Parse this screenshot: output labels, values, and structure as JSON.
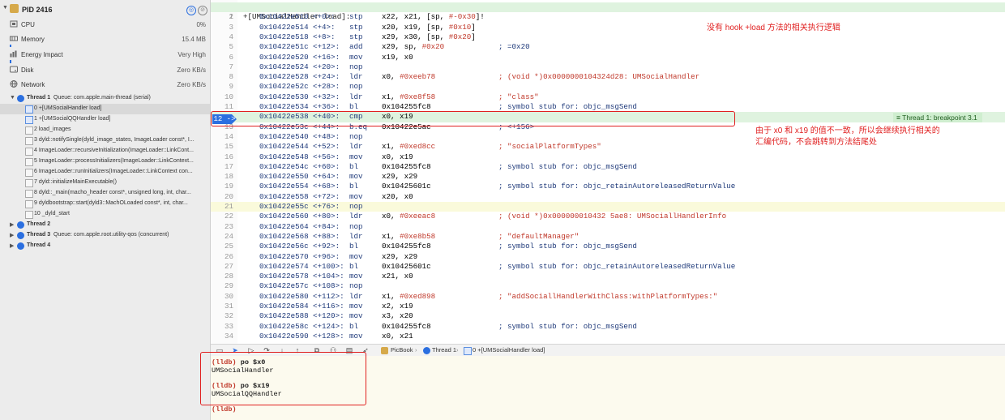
{
  "process": {
    "title": "PID 2416"
  },
  "gauges": [
    {
      "label": "CPU",
      "value": "0%"
    },
    {
      "label": "Memory",
      "value": "15.4 MB"
    },
    {
      "label": "Energy Impact",
      "value": "Very High"
    },
    {
      "label": "Disk",
      "value": "Zero KB/s"
    },
    {
      "label": "Network",
      "value": "Zero KB/s"
    }
  ],
  "thread1": {
    "label": "Thread 1",
    "queue": "Queue: com.apple.main-thread (serial)"
  },
  "frames": [
    "0 +[UMSocialHandler load]",
    "1 +[UMSocialQQHandler load]",
    "2 load_images",
    "3 dyld::notifySingle(dyld_image_states, ImageLoader const*, I...",
    "4 ImageLoader::recursiveInitialization(ImageLoader::LinkCont...",
    "5 ImageLoader::processInitializers(ImageLoader::LinkContext...",
    "6 ImageLoader::runInitializers(ImageLoader::LinkContext con...",
    "7 dyld::initializeMainExecutable()",
    "8 dyld::_main(macho_header const*, unsigned long, int, char...",
    "9 dyldbootstrap::start(dyld3::MachOLoaded const*, int, char...",
    "10 _dyld_start"
  ],
  "otherThreads": [
    {
      "label": "Thread 2",
      "queue": ""
    },
    {
      "label": "Thread 3",
      "queue": "Queue: com.apple.root.utility-qos (concurrent)"
    },
    {
      "label": "Thread 4",
      "queue": ""
    }
  ],
  "editorHeader": "+[UMSocialHandler load]:",
  "asm": [
    {
      "n": "2",
      "addr": "0x10422e510",
      "off": "<+0>:",
      "mn": "stp",
      "ops": "x22, x21, [sp, #-0x30]!"
    },
    {
      "n": "3",
      "addr": "0x10422e514",
      "off": "<+4>:",
      "mn": "stp",
      "ops": "x20, x19, [sp, #0x10]"
    },
    {
      "n": "4",
      "addr": "0x10422e518",
      "off": "<+8>:",
      "mn": "stp",
      "ops": "x29, x30, [sp, #0x20]"
    },
    {
      "n": "5",
      "addr": "0x10422e51c",
      "off": "<+12>:",
      "mn": "add",
      "ops": "x29, sp, #0x20",
      "cm": "; =0x20"
    },
    {
      "n": "6",
      "addr": "0x10422e520",
      "off": "<+16>:",
      "mn": "mov",
      "ops": "x19, x0"
    },
    {
      "n": "7",
      "addr": "0x10422e524",
      "off": "<+20>:",
      "mn": "nop",
      "ops": ""
    },
    {
      "n": "8",
      "addr": "0x10422e528",
      "off": "<+24>:",
      "mn": "ldr",
      "ops": "x0, #0xeeb78",
      "cm": "; (void *)0x0000000104324d28: UMSocialHandler"
    },
    {
      "n": "9",
      "addr": "0x10422e52c",
      "off": "<+28>:",
      "mn": "nop",
      "ops": ""
    },
    {
      "n": "10",
      "addr": "0x10422e530",
      "off": "<+32>:",
      "mn": "ldr",
      "ops": "x1, #0xe8f58",
      "cm": "; \"class\""
    },
    {
      "n": "11",
      "addr": "0x10422e534",
      "off": "<+36>:",
      "mn": "bl",
      "ops": "0x104255fc8",
      "cm": "; symbol stub for: objc_msgSend"
    },
    {
      "n": "12",
      "addr": "0x10422e538",
      "off": "<+40>:",
      "mn": "cmp",
      "ops": "x0, x19"
    },
    {
      "n": "13",
      "addr": "0x10422e53c",
      "off": "<+44>:",
      "mn": "b.eq",
      "ops": "0x10422e5ac",
      "cm": "; <+156>"
    },
    {
      "n": "14",
      "addr": "0x10422e540",
      "off": "<+48>:",
      "mn": "nop",
      "ops": ""
    },
    {
      "n": "15",
      "addr": "0x10422e544",
      "off": "<+52>:",
      "mn": "ldr",
      "ops": "x1, #0xed8cc",
      "cm": "; \"socialPlatformTypes\""
    },
    {
      "n": "16",
      "addr": "0x10422e548",
      "off": "<+56>:",
      "mn": "mov",
      "ops": "x0, x19"
    },
    {
      "n": "17",
      "addr": "0x10422e54c",
      "off": "<+60>:",
      "mn": "bl",
      "ops": "0x104255fc8",
      "cm": "; symbol stub for: objc_msgSend"
    },
    {
      "n": "18",
      "addr": "0x10422e550",
      "off": "<+64>:",
      "mn": "mov",
      "ops": "x29, x29"
    },
    {
      "n": "19",
      "addr": "0x10422e554",
      "off": "<+68>:",
      "mn": "bl",
      "ops": "0x10425601c",
      "cm": "; symbol stub for: objc_retainAutoreleasedReturnValue"
    },
    {
      "n": "20",
      "addr": "0x10422e558",
      "off": "<+72>:",
      "mn": "mov",
      "ops": "x20, x0"
    },
    {
      "n": "21",
      "addr": "0x10422e55c",
      "off": "<+76>:",
      "mn": "nop",
      "ops": ""
    },
    {
      "n": "22",
      "addr": "0x10422e560",
      "off": "<+80>:",
      "mn": "ldr",
      "ops": "x0, #0xeeac8",
      "cm": "; (void *)0x000000010432 5ae8: UMSociallHandlerInfo"
    },
    {
      "n": "23",
      "addr": "0x10422e564",
      "off": "<+84>:",
      "mn": "nop",
      "ops": ""
    },
    {
      "n": "24",
      "addr": "0x10422e568",
      "off": "<+88>:",
      "mn": "ldr",
      "ops": "x1, #0xe8b58",
      "cm": "; \"defaultManager\""
    },
    {
      "n": "25",
      "addr": "0x10422e56c",
      "off": "<+92>:",
      "mn": "bl",
      "ops": "0x104255fc8",
      "cm": "; symbol stub for: objc_msgSend"
    },
    {
      "n": "26",
      "addr": "0x10422e570",
      "off": "<+96>:",
      "mn": "mov",
      "ops": "x29, x29"
    },
    {
      "n": "27",
      "addr": "0x10422e574",
      "off": "<+100>:",
      "mn": "bl",
      "ops": "0x10425601c",
      "cm": "; symbol stub for: objc_retainAutoreleasedReturnValue"
    },
    {
      "n": "28",
      "addr": "0x10422e578",
      "off": "<+104>:",
      "mn": "mov",
      "ops": "x21, x0"
    },
    {
      "n": "29",
      "addr": "0x10422e57c",
      "off": "<+108>:",
      "mn": "nop",
      "ops": ""
    },
    {
      "n": "30",
      "addr": "0x10422e580",
      "off": "<+112>:",
      "mn": "ldr",
      "ops": "x1, #0xed898",
      "cm": "; \"addSociallHandlerWithClass:withPlatformTypes:\""
    },
    {
      "n": "31",
      "addr": "0x10422e584",
      "off": "<+116>:",
      "mn": "mov",
      "ops": "x2, x19"
    },
    {
      "n": "32",
      "addr": "0x10422e588",
      "off": "<+120>:",
      "mn": "mov",
      "ops": "x3, x20"
    },
    {
      "n": "33",
      "addr": "0x10422e58c",
      "off": "<+124>:",
      "mn": "bl",
      "ops": "0x104255fc8",
      "cm": "; symbol stub for: objc_msgSend"
    },
    {
      "n": "34",
      "addr": "0x10422e590",
      "off": "<+128>:",
      "mn": "mov",
      "ops": "x0, x21"
    }
  ],
  "breakpointLabel": "Thread 1: breakpoint 3.1",
  "annotations": {
    "top": "没有 hook +load 方法的相关执行逻辑",
    "right1": "由于 x0 和 x19 的值不一致，所以会继续执行相关的",
    "right2": "汇编代码，不会跳转到方法结尾处"
  },
  "debugBar": {
    "app": "PicBook",
    "thread": "Thread 1",
    "frame": "0 +[UMSocialHandler load]"
  },
  "console": [
    {
      "prompt": "(lldb)",
      "cmd": "po $x0"
    },
    {
      "out": "UMSocialHandler"
    },
    {
      "blank": ""
    },
    {
      "prompt": "(lldb)",
      "cmd": "po $x19"
    },
    {
      "out": "UMSocialQQHandler"
    },
    {
      "blank": ""
    },
    {
      "prompt": "(lldb)",
      "cmd": ""
    }
  ],
  "colors": {
    "accent": "#2b6fe0",
    "annotationRed": "#e02020",
    "highlightGreen": "#dff3df"
  }
}
